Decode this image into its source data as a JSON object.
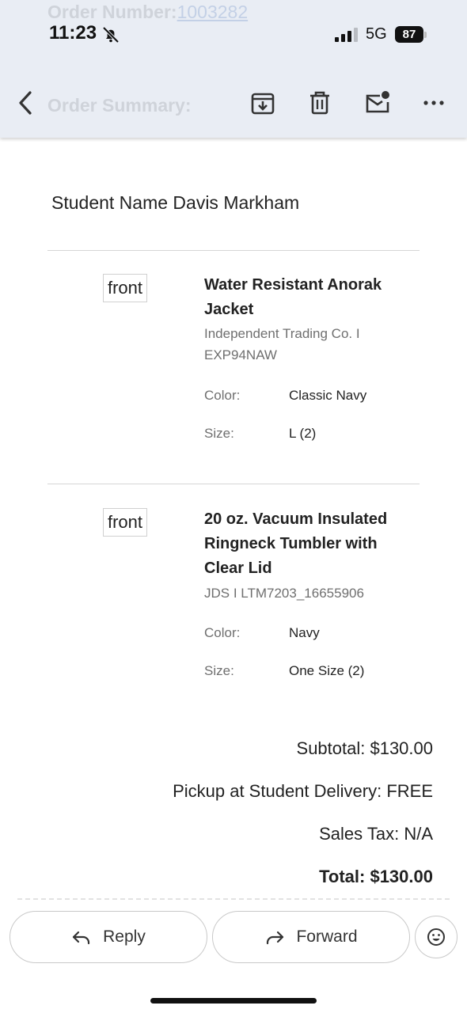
{
  "status_bar": {
    "time": "11:23",
    "network": "5G",
    "battery": "87"
  },
  "header": {
    "ghost_order_label": "Order Number:",
    "ghost_order_number": "1003282",
    "ghost_summary": "Order Summary:",
    "icons": [
      "back-arrow-icon",
      "archive-icon",
      "trash-icon",
      "mark-unread-icon",
      "more-icon"
    ]
  },
  "email": {
    "student_line": "Student Name Davis Markham",
    "items": [
      {
        "thumb": "front",
        "title_line1": "Water Resistant Anorak",
        "title_line2": "Jacket",
        "brand_line1": "Independent Trading Co. I",
        "brand_line2": "EXP94NAW",
        "color_label": "Color:",
        "color": "Classic Navy",
        "size_label": "Size:",
        "size": "L (2)"
      },
      {
        "thumb": "front",
        "title_line1": "20 oz. Vacuum Insulated",
        "title_line2": "Ringneck Tumbler with",
        "title_line3": "Clear Lid",
        "brand_line1": "JDS I LTM7203_16655906",
        "color_label": "Color:",
        "color": "Navy",
        "size_label": "Size:",
        "size": "One Size (2)"
      }
    ],
    "totals": {
      "subtotal": "Subtotal: $130.00",
      "pickup": "Pickup at Student Delivery: FREE",
      "tax": "Sales Tax: N/A",
      "total": "Total: $130.00"
    }
  },
  "actions": {
    "reply": "Reply",
    "forward": "Forward"
  },
  "colors": {
    "header_bg": "#e9edf4",
    "text": "#222222",
    "muted": "#6f6f6f"
  }
}
